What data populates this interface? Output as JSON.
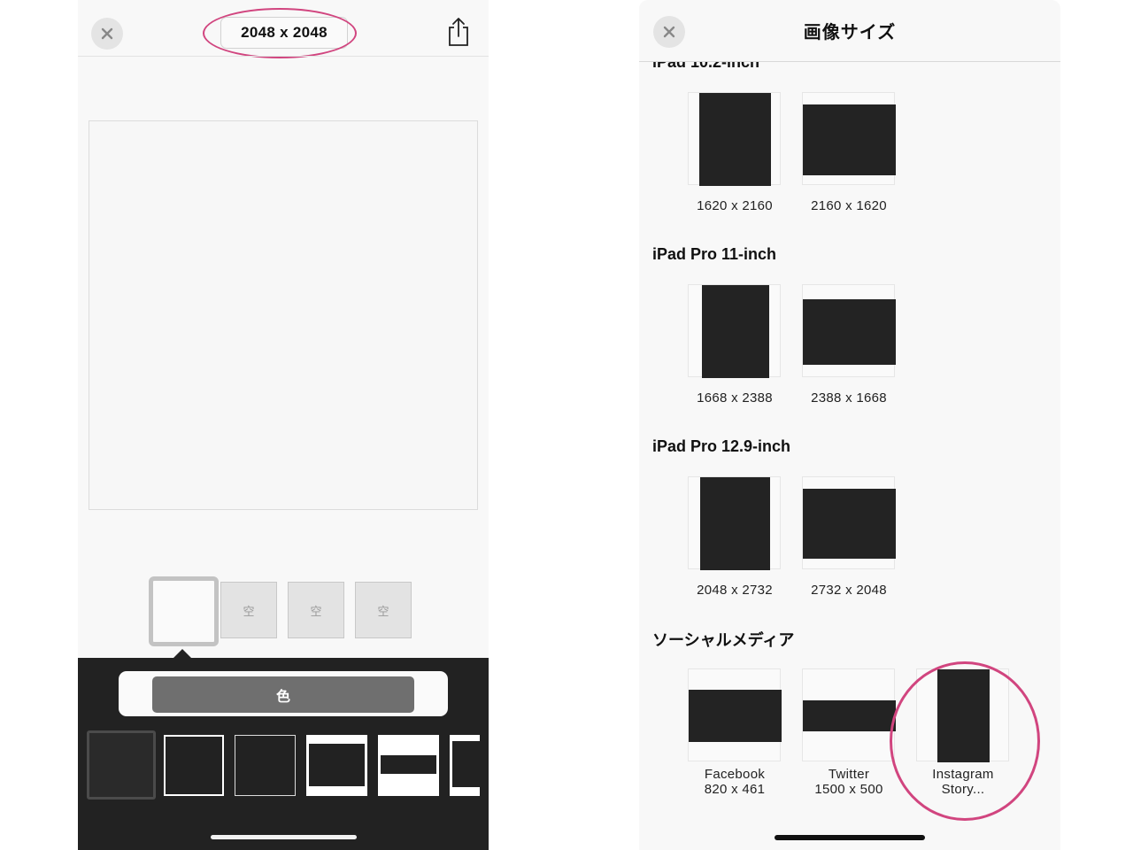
{
  "left_screen": {
    "size_label": "2048 x 2048",
    "slots": [
      "空",
      "空",
      "空"
    ],
    "color_button": "色"
  },
  "right_screen": {
    "title": "画像サイズ",
    "sections": [
      {
        "heading": "iPad 10.2-inch",
        "items": [
          {
            "label": "1620 x 2160"
          },
          {
            "label": "2160 x 1620"
          }
        ]
      },
      {
        "heading": "iPad Pro 11-inch",
        "items": [
          {
            "label": "1668 x 2388"
          },
          {
            "label": "2388 x 1668"
          }
        ]
      },
      {
        "heading": "iPad Pro 12.9-inch",
        "items": [
          {
            "label": "2048 x 2732"
          },
          {
            "label": "2732 x 2048"
          }
        ]
      },
      {
        "heading": "ソーシャルメディア",
        "items": [
          {
            "label": "Facebook",
            "sub": "820 x 461"
          },
          {
            "label": "Twitter",
            "sub": "1500 x 500"
          },
          {
            "label": "Instagram",
            "sub": "Story..."
          }
        ]
      }
    ]
  },
  "highlight_color": "#d1457f",
  "icons": [
    "close-icon",
    "share-icon"
  ]
}
